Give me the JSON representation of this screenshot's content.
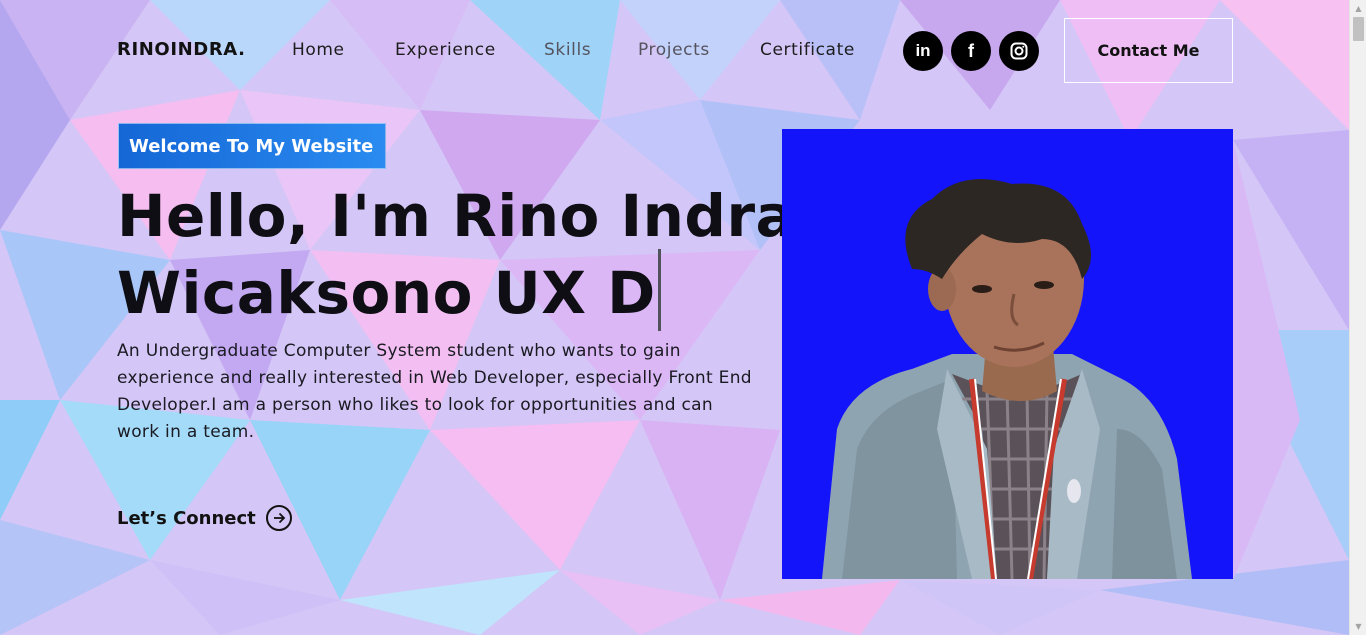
{
  "brand": "RINOINDRA.",
  "nav": {
    "items": [
      {
        "label": "Home"
      },
      {
        "label": "Experience"
      },
      {
        "label": "Skills"
      },
      {
        "label": "Projects"
      },
      {
        "label": "Certificate"
      }
    ],
    "social": [
      {
        "icon": "linkedin-icon",
        "glyph": "in"
      },
      {
        "icon": "facebook-icon",
        "glyph": "f"
      },
      {
        "icon": "instagram-icon",
        "glyph": ""
      }
    ],
    "contact_label": "Contact Me"
  },
  "hero": {
    "badge": "Welcome To My Website",
    "headline_line1": "Hello, I'm Rino Indra",
    "headline_line2": "Wicaksono UX D",
    "intro": "An Undergraduate Computer System student who wants to gain experience and really interested in Web Developer, especially Front End Developer.I am a person who likes to look for opportunities and can work in a team.",
    "cta_label": "Let’s Connect",
    "photo_background": "#1414fb"
  },
  "colors": {
    "accent_blue": "#1567d6",
    "text_dark": "#121212"
  }
}
